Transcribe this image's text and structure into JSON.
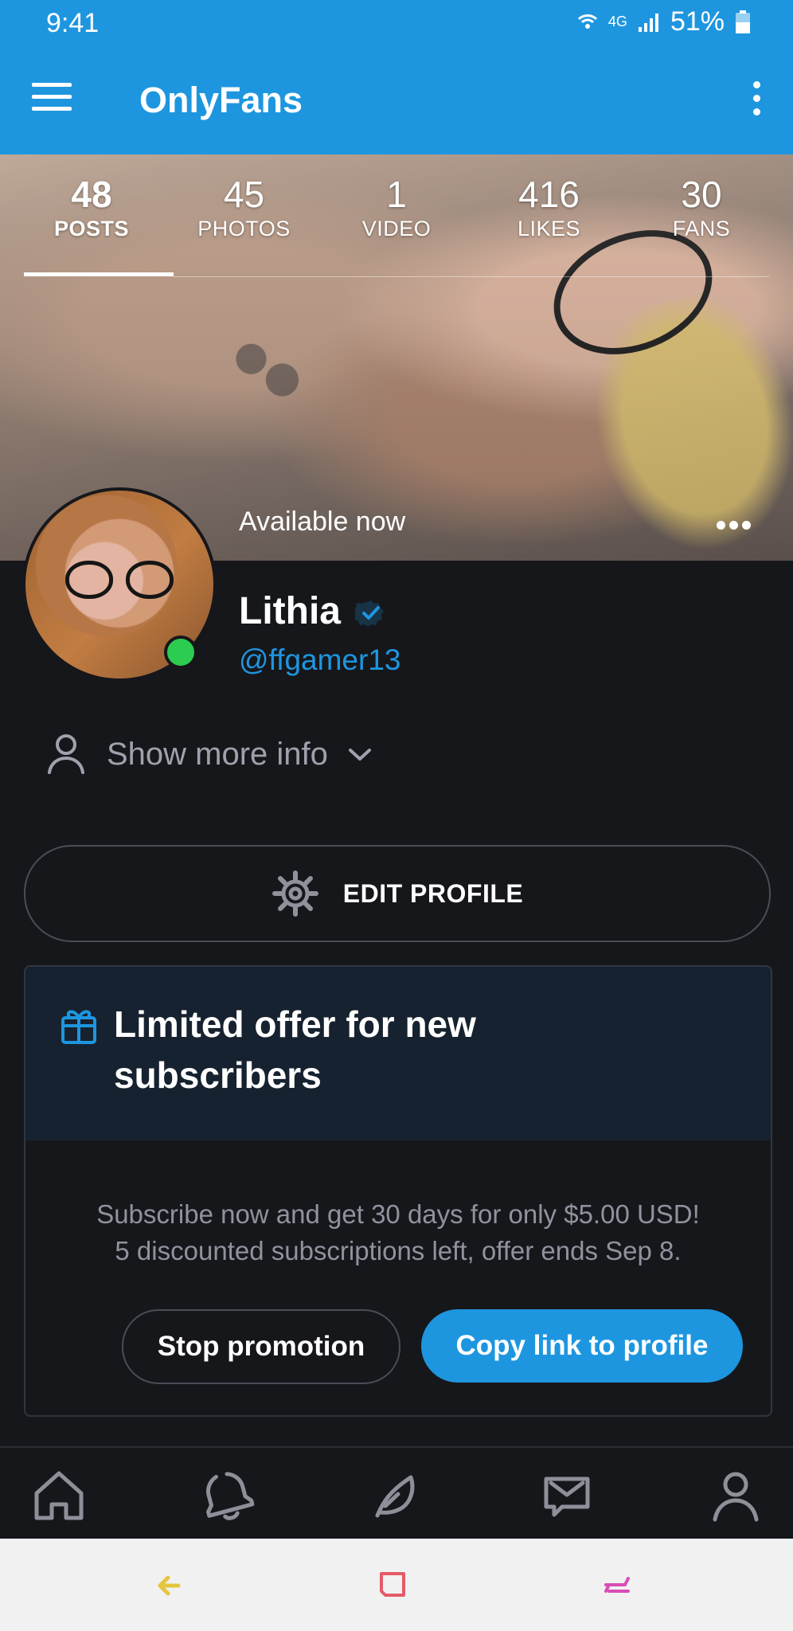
{
  "status_bar": {
    "time": "9:41",
    "network": "4G",
    "battery": "51%"
  },
  "app_bar": {
    "title": "OnlyFans"
  },
  "profile_stats": {
    "tabs": [
      {
        "value": "48",
        "label": "POSTS",
        "active": true
      },
      {
        "value": "45",
        "label": "PHOTOS"
      },
      {
        "value": "1",
        "label": "VIDEO"
      },
      {
        "value": "416",
        "label": "LIKES"
      },
      {
        "value": "30",
        "label": "FANS"
      }
    ]
  },
  "profile": {
    "availability": "Available now",
    "display_name": "Lithia",
    "handle": "@ffgamer13",
    "show_more": "Show more info"
  },
  "actions": {
    "edit_profile": "EDIT PROFILE"
  },
  "offer": {
    "title": "Limited offer for new subscribers",
    "line1": "Subscribe now and get 30 days for only $5.00 USD!",
    "line2": "5 discounted subscriptions left, offer ends Sep 8.",
    "stop_button": "Stop promotion",
    "copy_button": "Copy link to profile"
  },
  "bottom_nav": {
    "items": [
      "home-icon",
      "bell-icon",
      "feather-icon",
      "messages-icon",
      "profile-icon"
    ]
  },
  "system_nav": {
    "back": "back-icon",
    "recent": "recent-apps-icon",
    "home": "system-home-icon"
  },
  "colors": {
    "brand_blue": "#1e96df",
    "dark_bg": "#16171b",
    "online_green": "#2ccc50"
  }
}
